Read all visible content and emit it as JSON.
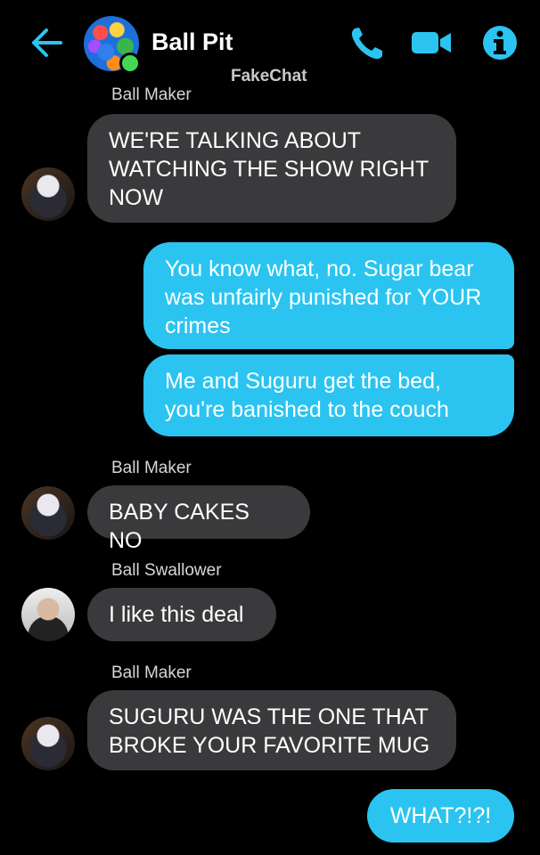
{
  "header": {
    "title": "Ball Pit",
    "watermark": "FakeChat",
    "accent_color": "#2bc4f0",
    "icons": [
      "back-arrow-icon",
      "phone-icon",
      "video-camera-icon",
      "info-icon"
    ]
  },
  "messages": [
    {
      "sender": "Ball Maker",
      "text": "WE'RE TALKING ABOUT WATCHING THE SHOW RIGHT NOW"
    },
    {
      "text": "You know what, no.  Sugar bear was unfairly punished for YOUR crimes"
    },
    {
      "text": "Me and Suguru get the bed, you're banished to the couch"
    },
    {
      "sender": "Ball Maker",
      "text": "BABY CAKES NO"
    },
    {
      "sender": "Ball Swallower",
      "text": "I like this deal"
    },
    {
      "sender": "Ball Maker",
      "text": "SUGURU WAS THE ONE THAT BROKE YOUR FAVORITE MUG"
    },
    {
      "text": "WHAT?!?!"
    }
  ]
}
